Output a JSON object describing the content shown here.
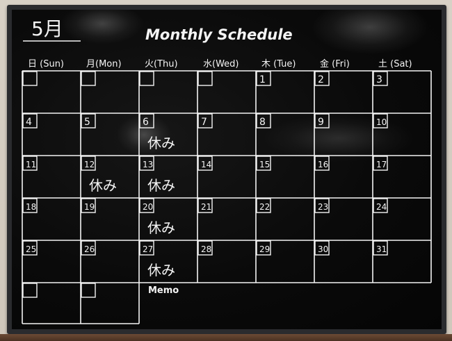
{
  "board": {
    "month_label": "5月",
    "title": "Monthly Schedule",
    "memo_label": "Memo",
    "rest_label": "休み"
  },
  "weekdays": [
    "日 (Sun)",
    "月(Mon)",
    "火(Thu)",
    "水(Wed)",
    "木 (Tue)",
    "金 (Fri)",
    "土 (Sat)"
  ],
  "calendar": {
    "rows": [
      [
        "",
        "",
        "",
        "",
        "1",
        "2",
        "3"
      ],
      [
        "4",
        "5",
        "6",
        "7",
        "8",
        "9",
        "10"
      ],
      [
        "11",
        "12",
        "13",
        "14",
        "15",
        "16",
        "17"
      ],
      [
        "18",
        "19",
        "20",
        "21",
        "22",
        "23",
        "24"
      ],
      [
        "25",
        "26",
        "27",
        "28",
        "29",
        "30",
        "31"
      ],
      [
        "",
        ""
      ]
    ],
    "rest_days": [
      "6",
      "12",
      "13",
      "20",
      "27"
    ]
  },
  "colors": {
    "board_surface": "#0a0a0a",
    "frame": "#2a2b2e",
    "chalk": "#f4f4f4",
    "wall": "#d8d1c6"
  }
}
